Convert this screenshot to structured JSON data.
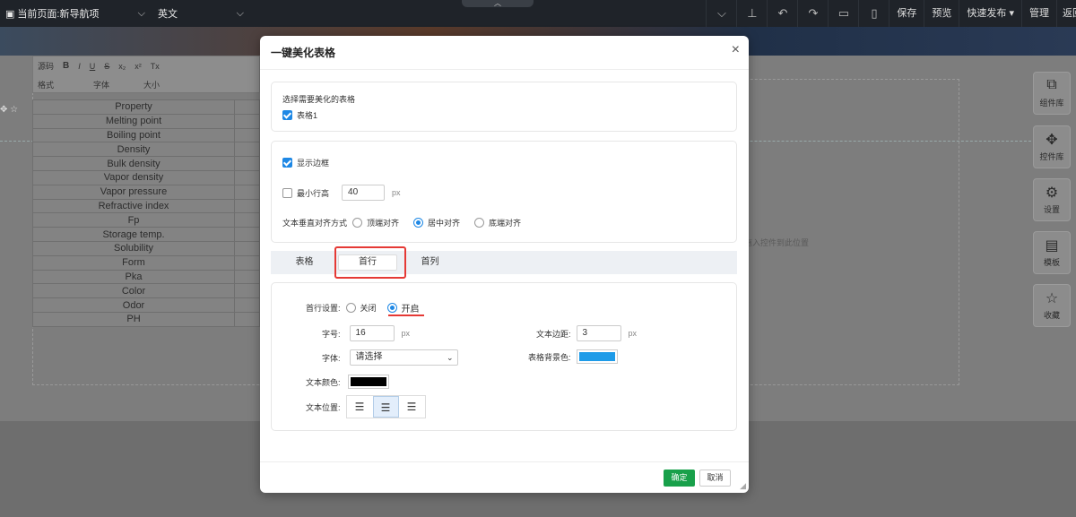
{
  "topbar": {
    "page_label": "当前页面:新导航项",
    "lang_label": "英文",
    "links": [
      "保存",
      "预览",
      "快速发布 ▾",
      "管理",
      "返回"
    ]
  },
  "editor": {
    "toolbar_row1": [
      "源码",
      "B",
      "I",
      "U",
      "S",
      "x₂",
      "x²",
      "Tx"
    ],
    "toolbar_row2": [
      "格式",
      "字体",
      "大小"
    ],
    "table_rows": [
      "Property",
      "Melting point",
      "Boiling point",
      "Density",
      "Bulk density",
      "Vapor density",
      "Vapor pressure",
      "Refractive index",
      "Fp",
      "Storage temp.",
      "Solubility",
      "Form",
      "Pka",
      "Color",
      "Odor",
      "PH"
    ],
    "hint": "拖入控件到此位置"
  },
  "dock": [
    {
      "label": "组件库",
      "icon": "component-library-icon",
      "glyph": "⧉"
    },
    {
      "label": "控件库",
      "icon": "puzzle-icon",
      "glyph": "✥"
    },
    {
      "label": "设置",
      "icon": "gear-icon",
      "glyph": "⚙"
    },
    {
      "label": "模板",
      "icon": "template-icon",
      "glyph": "▤"
    },
    {
      "label": "收藏",
      "icon": "star-icon",
      "glyph": "☆"
    }
  ],
  "modal": {
    "title": "一键美化表格",
    "close": "×",
    "select_table_title": "选择需要美化的表格",
    "table1_label": "表格1",
    "show_border_label": "显示边框",
    "min_row_height_label": "最小行高",
    "min_row_height_value": "40",
    "px": "px",
    "valign_label": "文本垂直对齐方式",
    "valign_options": [
      "顶端对齐",
      "居中对齐",
      "底端对齐"
    ],
    "tabs": [
      "表格",
      "首行",
      "首列"
    ],
    "first_row_setting_label": "首行设置:",
    "off_label": "关闭",
    "on_label": "开启",
    "font_size_label": "字号:",
    "font_size_value": "16",
    "padding_label": "文本边距:",
    "padding_value": "3",
    "font_label": "字体:",
    "font_placeholder": "请选择",
    "bg_color_label": "表格背景色:",
    "bg_color": "#1e9be8",
    "text_color_label": "文本颜色:",
    "text_color": "#000000",
    "text_pos_label": "文本位置:",
    "ok": "确定",
    "cancel": "取消"
  }
}
